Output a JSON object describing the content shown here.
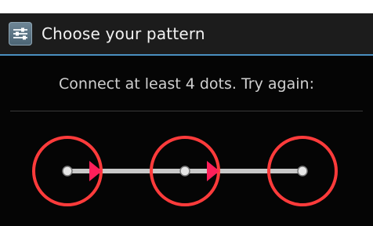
{
  "header": {
    "title": "Choose your pattern",
    "icon": "settings-sliders-icon"
  },
  "instructions": "Connect at least 4 dots. Try again:",
  "pattern": {
    "state": "wrong",
    "selected_dots": [
      1,
      2,
      3
    ],
    "colors": {
      "ring": "#ff3b3b",
      "line": "#c8c8c8",
      "dot": "#e6e6e6",
      "arrow": "#ff1f5a"
    }
  },
  "colors": {
    "background": "#050505",
    "action_bar": "#1c1c1c",
    "accent": "#4a8fbf"
  }
}
